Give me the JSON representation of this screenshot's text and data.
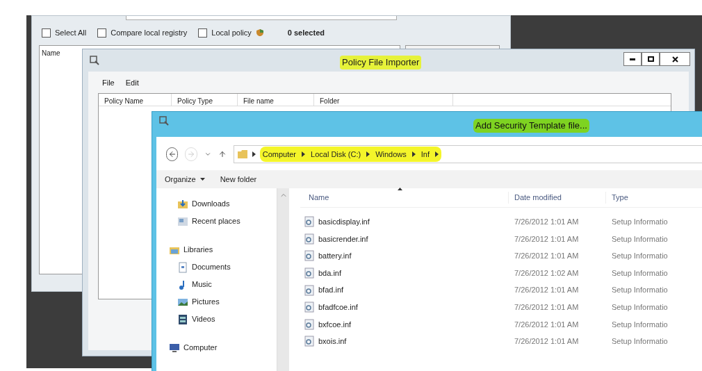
{
  "back_window": {
    "checkboxes": [
      {
        "label": "Select All",
        "checked": false
      },
      {
        "label": "Compare local registry",
        "checked": false
      },
      {
        "label": "Local policy",
        "checked": false
      }
    ],
    "selected_count": "0 selected",
    "list_header": "Name"
  },
  "importer": {
    "title": "Policy File Importer",
    "title_highlighted": true,
    "menu": [
      "File",
      "Edit"
    ],
    "columns": [
      "Policy Name",
      "Policy Type",
      "File name",
      "Folder"
    ]
  },
  "file_dialog": {
    "title": "Add Security Template file...",
    "title_highlighted": true,
    "breadcrumb": [
      "Computer",
      "Local Disk (C:)",
      "Windows",
      "Inf"
    ],
    "breadcrumb_highlighted": true,
    "toolbar": [
      "Organize",
      "New folder"
    ],
    "nav": [
      {
        "items": [
          {
            "label": "Downloads",
            "kind": "downloads"
          },
          {
            "label": "Recent places",
            "kind": "recent"
          }
        ]
      },
      {
        "label": "Libraries",
        "kind": "libraries",
        "children": [
          {
            "label": "Documents",
            "kind": "documents"
          },
          {
            "label": "Music",
            "kind": "music"
          },
          {
            "label": "Pictures",
            "kind": "pictures"
          },
          {
            "label": "Videos",
            "kind": "videos"
          }
        ]
      },
      {
        "label": "Computer",
        "kind": "computer"
      }
    ],
    "columns": [
      "Name",
      "Date modified",
      "Type"
    ],
    "files": [
      {
        "name": "basicdisplay.inf",
        "date": "7/26/2012 1:01 AM",
        "type": "Setup Informatio"
      },
      {
        "name": "basicrender.inf",
        "date": "7/26/2012 1:01 AM",
        "type": "Setup Informatio"
      },
      {
        "name": "battery.inf",
        "date": "7/26/2012 1:01 AM",
        "type": "Setup Informatio"
      },
      {
        "name": "bda.inf",
        "date": "7/26/2012 1:02 AM",
        "type": "Setup Informatio"
      },
      {
        "name": "bfad.inf",
        "date": "7/26/2012 1:01 AM",
        "type": "Setup Informatio"
      },
      {
        "name": "bfadfcoe.inf",
        "date": "7/26/2012 1:01 AM",
        "type": "Setup Informatio"
      },
      {
        "name": "bxfcoe.inf",
        "date": "7/26/2012 1:01 AM",
        "type": "Setup Informatio"
      },
      {
        "name": "bxois.inf",
        "date": "7/26/2012 1:01 AM",
        "type": "Setup Informatio"
      }
    ]
  }
}
